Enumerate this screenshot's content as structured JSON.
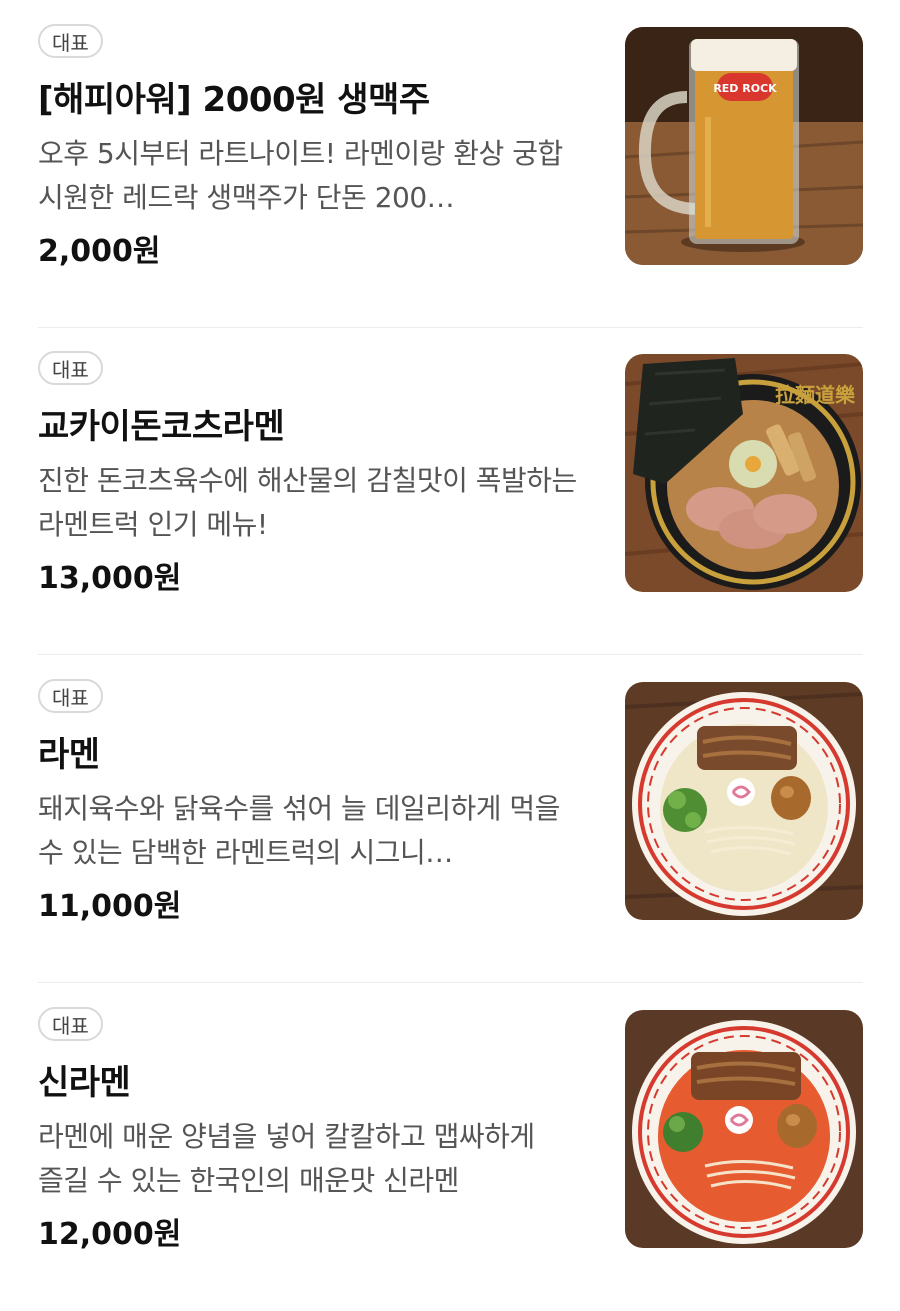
{
  "menu": {
    "items": [
      {
        "badge": "대표",
        "name": "[해피아워] 2000원 생맥주",
        "description": "오후 5시부터 라트나이트! 라멘이랑 환상 궁합 시원한 레드락 생맥주가 단돈 200…",
        "price": "2,000원",
        "photo_label": "RED ROCK"
      },
      {
        "badge": "대표",
        "name": "교카이돈코츠라멘",
        "description": "진한 돈코츠육수에 해산물의 감칠맛이 폭발하는 라멘트럭 인기 메뉴!",
        "price": "13,000원",
        "photo_label": "拉麵道樂"
      },
      {
        "badge": "대표",
        "name": "라멘",
        "description": "돼지육수와 닭육수를 섞어 늘 데일리하게 먹을 수 있는 담백한 라멘트럭의 시그니…",
        "price": "11,000원"
      },
      {
        "badge": "대표",
        "name": "신라멘",
        "description": "라멘에 매운 양념을 넣어 칼칼하고 맵싸하게 즐길 수 있는 한국인의 매운맛 신라멘",
        "price": "12,000원"
      }
    ]
  }
}
